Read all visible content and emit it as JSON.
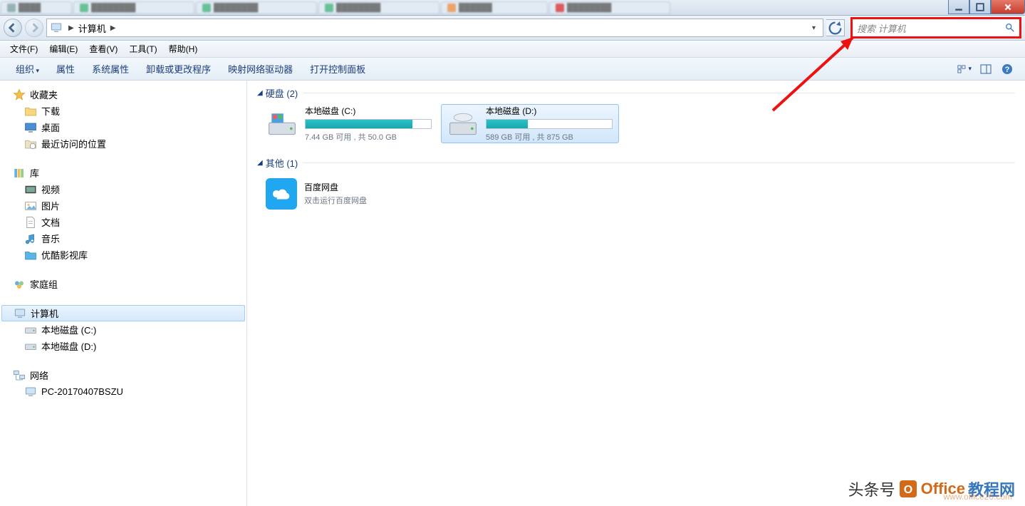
{
  "breadcrumb": {
    "location": "计算机"
  },
  "search": {
    "placeholder": "搜索 计算机"
  },
  "menubar": {
    "file": "文件(F)",
    "edit": "编辑(E)",
    "view": "查看(V)",
    "tools": "工具(T)",
    "help": "帮助(H)"
  },
  "toolbar": {
    "organize": "组织",
    "properties": "属性",
    "sysprops": "系统属性",
    "uninstall": "卸载或更改程序",
    "mapdrive": "映射网络驱动器",
    "controlpanel": "打开控制面板"
  },
  "sidebar": {
    "favorites": {
      "label": "收藏夹",
      "items": [
        "下载",
        "桌面",
        "最近访问的位置"
      ]
    },
    "libraries": {
      "label": "库",
      "items": [
        "视频",
        "图片",
        "文档",
        "音乐",
        "优酷影视库"
      ]
    },
    "homegroup": {
      "label": "家庭组"
    },
    "computer": {
      "label": "计算机",
      "items": [
        "本地磁盘 (C:)",
        "本地磁盘 (D:)"
      ]
    },
    "network": {
      "label": "网络",
      "items": [
        "PC-20170407BSZU"
      ]
    }
  },
  "groups": {
    "hdd": {
      "label": "硬盘 (2)"
    },
    "other": {
      "label": "其他 (1)"
    }
  },
  "drives": [
    {
      "name": "本地磁盘 (C:)",
      "space": "7.44 GB 可用 , 共 50.0 GB",
      "fill": 85
    },
    {
      "name": "本地磁盘 (D:)",
      "space": "589 GB 可用 , 共 875 GB",
      "fill": 33,
      "selected": true
    }
  ],
  "others": [
    {
      "name": "百度网盘",
      "sub": "双击运行百度网盘"
    }
  ],
  "watermark": {
    "pre": "头条号",
    "brand1": "Office",
    "brand2": "教程网",
    "url": "www.office26.com"
  }
}
